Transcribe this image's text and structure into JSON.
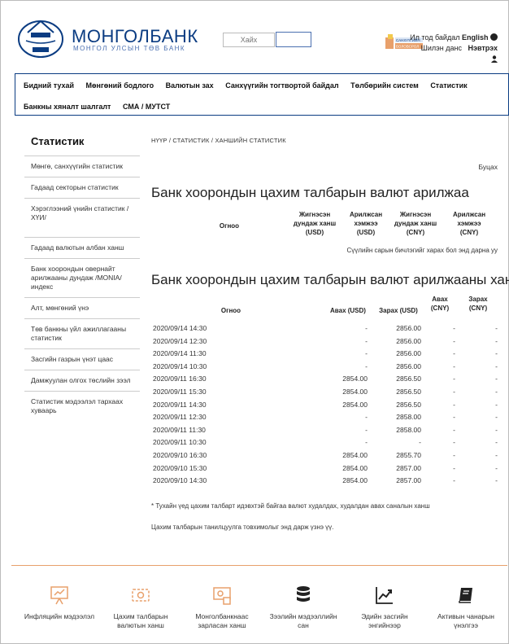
{
  "header": {
    "brand_name": "МОНГОЛБАНК",
    "brand_sub": "МОНГОЛ УЛСЫН ТӨВ БАНК",
    "search_placeholder": "Хайх",
    "promo_text_1": "САНХҮҮГИЙН",
    "promo_text_2": "БОЛОВСРОЛ",
    "links_line1_pre": "Ил тод байдал",
    "links_line1_lang": "English",
    "links_line2_a": "Шилэн данс",
    "links_line2_b": "Нэвтрэх"
  },
  "nav": {
    "row1": [
      "Бидний тухай",
      "Мөнгөний бодлого",
      "Валютын зах",
      "Санхүүгийн тогтвортой байдал",
      "Төлбөрийн систем",
      "Статистик"
    ],
    "row2": [
      "Банкны хяналт шалгалт",
      "СМА / МУТСТ"
    ]
  },
  "sidebar": {
    "title": "Статистик",
    "items": [
      "Мөнгө, санхүүгийн статистик",
      "Гадаад секторын статистик",
      "Хэрэглээний үнийн статистик /ХҮИ/",
      "Гадаад валютын албан ханш",
      "Банк хоорондын овернайт арилжааны дундаж /MONIA/ индекс",
      "Алт, мөнгөний үнэ",
      "Төв банкны үйл ажиллагааны статистик",
      "Засгийн газрын үнэт цаас",
      "Дамжуулан олгох төслийн зээл",
      "Статистик мэдээлэл тархаах хуваарь"
    ]
  },
  "breadcrumb": "НҮҮР  /  СТАТИСТИК  /  ХАНШИЙН СТАТИСТИК",
  "back_label": "Буцах",
  "table1": {
    "title": "Банк хоорондын цахим талбарын валют арилжаа",
    "headers": [
      "Огноо",
      "Жигнэсэн дундаж ханш (USD)",
      "Арилжсан хэмжээ (USD)",
      "Жигнэсэн дундаж ханш (CNY)",
      "Арилжсан хэмжээ (CNY)"
    ],
    "note": "Сүүлийн сарын бичлэгийг харах бол энд дарна уу"
  },
  "table2": {
    "title": "Банк хоорондын цахим талбарын валют арилжааны ханш *",
    "headers": [
      "Огноо",
      "Авах (USD)",
      "Зарах (USD)",
      "Авах (CNY)",
      "Зарах (CNY)"
    ],
    "rows": [
      [
        "2020/09/14 14:30",
        "-",
        "2856.00",
        "-",
        "-"
      ],
      [
        "2020/09/14 12:30",
        "-",
        "2856.00",
        "-",
        "-"
      ],
      [
        "2020/09/14 11:30",
        "-",
        "2856.00",
        "-",
        "-"
      ],
      [
        "2020/09/14 10:30",
        "-",
        "2856.00",
        "-",
        "-"
      ],
      [
        "2020/09/11 16:30",
        "2854.00",
        "2856.50",
        "-",
        "-"
      ],
      [
        "2020/09/11 15:30",
        "2854.00",
        "2856.50",
        "-",
        "-"
      ],
      [
        "2020/09/11 14:30",
        "2854.00",
        "2856.50",
        "-",
        "-"
      ],
      [
        "2020/09/11 12:30",
        "-",
        "2858.00",
        "-",
        "-"
      ],
      [
        "2020/09/11 11:30",
        "-",
        "2858.00",
        "-",
        "-"
      ],
      [
        "2020/09/11 10:30",
        "-",
        "-",
        "-",
        "-"
      ],
      [
        "2020/09/10 16:30",
        "2854.00",
        "2855.70",
        "-",
        "-"
      ],
      [
        "2020/09/10 15:30",
        "2854.00",
        "2857.00",
        "-",
        "-"
      ],
      [
        "2020/09/10 14:30",
        "2854.00",
        "2857.00",
        "-",
        "-"
      ]
    ],
    "note1": "* Тухайн үед цахим талбарт идэвхтэй байгаа валют худалдах, худалдан авах саналын ханш",
    "note2": "Цахим талбарын танилцуулга товхимолыг энд дарж үзнэ үү."
  },
  "footer": {
    "items": [
      {
        "label": "Инфляцийн мэдээлэл",
        "icon": "presentation-chart-icon"
      },
      {
        "label": "Цахим талбарын валютын ханш",
        "icon": "exchange-icon"
      },
      {
        "label": "Монголбанкнаас зарласан ханш",
        "icon": "currency-board-icon"
      },
      {
        "label": "Зээлийн мэдээллийн сан",
        "icon": "database-icon"
      },
      {
        "label": "Эдийн засгийн энгийнээр",
        "icon": "trend-chart-icon"
      },
      {
        "label": "Активын чанарын үнэлгээ",
        "icon": "book-icon"
      }
    ]
  },
  "colors": {
    "brand_blue": "#0b3c82",
    "footer_rule": "#e8a06b",
    "footer_icon": "#e8a06b"
  }
}
